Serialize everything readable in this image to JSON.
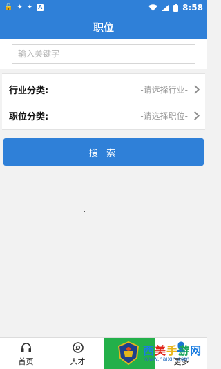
{
  "status_bar": {
    "time": "8:58",
    "left_icons": [
      "lock-icon",
      "bug-icon",
      "bug-icon",
      "a-badge-icon"
    ],
    "right_icons": [
      "wifi-icon",
      "signal-icon",
      "battery-icon"
    ],
    "bg_color": "#2f80d8"
  },
  "header": {
    "title": "职位"
  },
  "search": {
    "placeholder": "输入关键字",
    "value": ""
  },
  "filters": {
    "industry": {
      "label": "行业分类:",
      "value": "-请选择行业-"
    },
    "position": {
      "label": "职位分类:",
      "value": "-请选择职位-"
    }
  },
  "search_button": {
    "label": "搜 索"
  },
  "tabbar": [
    {
      "label": "首页",
      "icon": "headphones-icon"
    },
    {
      "label": "人才",
      "icon": "disc-icon"
    },
    {
      "label": "",
      "icon": "active-tab",
      "active": true
    },
    {
      "label": "更多",
      "icon": "person-icon"
    }
  ],
  "watermark": {
    "text": "西美手游网",
    "url": "www.haixin.com"
  },
  "colors": {
    "primary": "#2f80d8",
    "active_tab": "#23b04a",
    "placeholder": "#b5b5b5"
  }
}
